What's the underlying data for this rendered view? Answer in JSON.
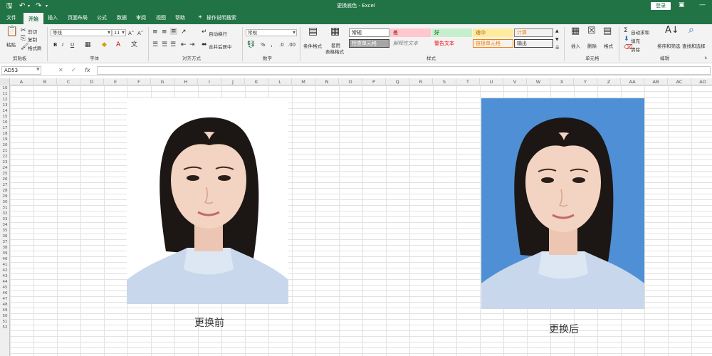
{
  "window": {
    "title": "更换底色 - Excel",
    "login_label": "登录"
  },
  "tabs": [
    {
      "label": "文件"
    },
    {
      "label": "开始"
    },
    {
      "label": "插入"
    },
    {
      "label": "页面布局"
    },
    {
      "label": "公式"
    },
    {
      "label": "数据"
    },
    {
      "label": "审阅"
    },
    {
      "label": "视图"
    },
    {
      "label": "帮助"
    },
    {
      "label": "操作说明搜索"
    }
  ],
  "ribbon": {
    "clipboard": {
      "paste": "粘贴",
      "cut": "剪切",
      "copy": "复制",
      "format_painter": "格式刷",
      "label": "剪贴板"
    },
    "font": {
      "name": "等线",
      "size": "11",
      "bold": "B",
      "italic": "I",
      "underline": "U",
      "label": "字体"
    },
    "alignment": {
      "wrap": "自动换行",
      "merge": "合并后居中",
      "label": "对齐方式"
    },
    "number": {
      "format": "常规",
      "percent": "%",
      "label": "数字"
    },
    "styles": {
      "conditional": "条件格式",
      "table_format_1": "套用",
      "table_format_2": "表格格式",
      "cells": [
        {
          "text": "常规",
          "bg": "#ffffff",
          "fg": "#222222",
          "border": "#888888"
        },
        {
          "text": "差",
          "bg": "#ffc7ce",
          "fg": "#9c0006",
          "border": "#ffc7ce"
        },
        {
          "text": "好",
          "bg": "#c6efce",
          "fg": "#006100",
          "border": "#c6efce"
        },
        {
          "text": "适中",
          "bg": "#ffeb9c",
          "fg": "#9c5700",
          "border": "#ffeb9c"
        },
        {
          "text": "计算",
          "bg": "#f2f2f2",
          "fg": "#fa7d00",
          "border": "#7f7f7f"
        },
        {
          "text": "检查单元格",
          "bg": "#a5a5a5",
          "fg": "#ffffff",
          "border": "#3f3f3f"
        },
        {
          "text": "解释性文本",
          "bg": "#f3f3f3",
          "fg": "#7f7f7f",
          "border": "#f3f3f3"
        },
        {
          "text": "警告文本",
          "bg": "#f3f3f3",
          "fg": "#ff0000",
          "border": "#f3f3f3"
        },
        {
          "text": "链接单元格",
          "bg": "#f3f3f3",
          "fg": "#fa7d00",
          "border": "#fa7d00"
        },
        {
          "text": "输出",
          "bg": "#f2f2f2",
          "fg": "#3f3f3f",
          "border": "#3f3f3f"
        }
      ],
      "label": "样式"
    },
    "cells": {
      "insert": "插入",
      "delete": "删除",
      "format": "格式",
      "label": "单元格"
    },
    "editing": {
      "autosum": "自动求和",
      "fill": "填充",
      "clear": "清除",
      "sort": "排序和筛选",
      "find": "查找和选择",
      "label": "编辑"
    }
  },
  "formula_bar": {
    "name_box": "AD53",
    "fx": "fx"
  },
  "columns": [
    "A",
    "B",
    "C",
    "D",
    "E",
    "F",
    "G",
    "H",
    "I",
    "J",
    "K",
    "L",
    "M",
    "N",
    "O",
    "P",
    "Q",
    "R",
    "S",
    "T",
    "U",
    "V",
    "W",
    "X",
    "Y",
    "Z",
    "AA",
    "AB",
    "AC",
    "AD"
  ],
  "rows": [
    "10",
    "11",
    "12",
    "13",
    "14",
    "15",
    "16",
    "17",
    "18",
    "19",
    "20",
    "21",
    "22",
    "23",
    "24",
    "25",
    "26",
    "27",
    "28",
    "29",
    "30",
    "31",
    "32",
    "33",
    "34",
    "35",
    "36",
    "37",
    "38",
    "39",
    "40",
    "41",
    "42",
    "43",
    "44",
    "45",
    "46",
    "47",
    "48",
    "49",
    "50",
    "51",
    "52"
  ],
  "photos": {
    "before_caption": "更换前",
    "after_caption": "更换后",
    "after_bg": "#4f8fd6"
  },
  "colors": {
    "accent": "#217346"
  }
}
